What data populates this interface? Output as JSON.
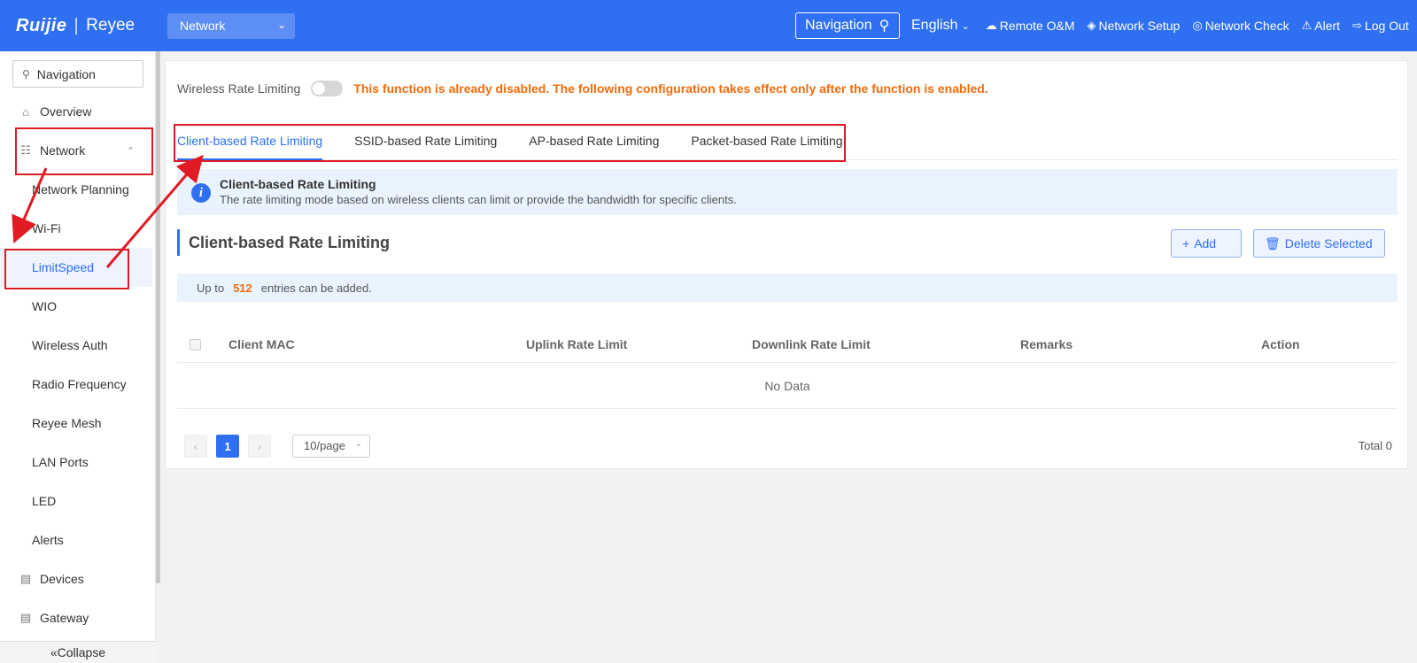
{
  "topbar": {
    "logo_brand": "Ruijie",
    "logo_sub": "Reyee",
    "network_select": "Network",
    "nav_search_label": "Navigation",
    "language": "English",
    "links": [
      "Remote O&M",
      "Network Setup",
      "Network Check",
      "Alert",
      "Log Out"
    ]
  },
  "sidebar": {
    "search_placeholder": "Navigation",
    "items": [
      {
        "label": "Overview",
        "icon": "home-icon"
      },
      {
        "label": "Network",
        "icon": "network-icon"
      },
      {
        "label": "Network Planning"
      },
      {
        "label": "Wi-Fi"
      },
      {
        "label": "LimitSpeed"
      },
      {
        "label": "WIO"
      },
      {
        "label": "Wireless Auth"
      },
      {
        "label": "Radio Frequency"
      },
      {
        "label": "Reyee Mesh"
      },
      {
        "label": "LAN Ports"
      },
      {
        "label": "LED"
      },
      {
        "label": "Alerts"
      },
      {
        "label": "Devices",
        "icon": "devices-icon"
      },
      {
        "label": "Gateway",
        "icon": "gateway-icon"
      }
    ],
    "collapse": "Collapse"
  },
  "main": {
    "toggle_label": "Wireless Rate Limiting",
    "toggle_enabled": false,
    "warning": "This function is already disabled. The following configuration takes effect only after the function is enabled.",
    "tabs": [
      "Client-based Rate Limiting",
      "SSID-based Rate Limiting",
      "AP-based Rate Limiting",
      "Packet-based Rate Limiting"
    ],
    "info_title": "Client-based Rate Limiting",
    "info_text": "The rate limiting mode based on wireless clients can limit or provide the bandwidth for specific clients.",
    "section_title": "Client-based Rate Limiting",
    "add_button": "Add",
    "delete_button": "Delete Selected",
    "note_prefix": "Up to",
    "note_count": "512",
    "note_suffix": "entries can be added.",
    "columns": [
      "Client MAC",
      "Uplink Rate Limit",
      "Downlink Rate Limit",
      "Remarks",
      "Action"
    ],
    "empty_text": "No Data",
    "current_page": "1",
    "page_size": "10/page",
    "total": "Total 0"
  },
  "colors": {
    "accent": "#2f6ff1",
    "warning": "#f06c0c",
    "annotation": "#e01b24"
  }
}
